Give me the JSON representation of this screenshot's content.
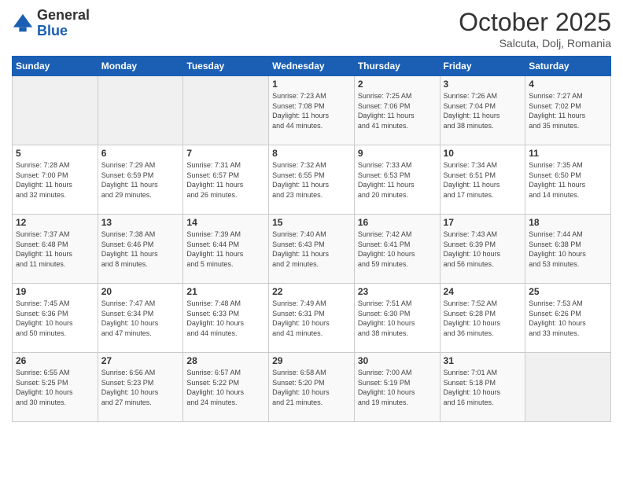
{
  "header": {
    "logo_general": "General",
    "logo_blue": "Blue",
    "month": "October 2025",
    "location": "Salcuta, Dolj, Romania"
  },
  "days_of_week": [
    "Sunday",
    "Monday",
    "Tuesday",
    "Wednesday",
    "Thursday",
    "Friday",
    "Saturday"
  ],
  "weeks": [
    [
      {
        "num": "",
        "info": ""
      },
      {
        "num": "",
        "info": ""
      },
      {
        "num": "",
        "info": ""
      },
      {
        "num": "1",
        "info": "Sunrise: 7:23 AM\nSunset: 7:08 PM\nDaylight: 11 hours\nand 44 minutes."
      },
      {
        "num": "2",
        "info": "Sunrise: 7:25 AM\nSunset: 7:06 PM\nDaylight: 11 hours\nand 41 minutes."
      },
      {
        "num": "3",
        "info": "Sunrise: 7:26 AM\nSunset: 7:04 PM\nDaylight: 11 hours\nand 38 minutes."
      },
      {
        "num": "4",
        "info": "Sunrise: 7:27 AM\nSunset: 7:02 PM\nDaylight: 11 hours\nand 35 minutes."
      }
    ],
    [
      {
        "num": "5",
        "info": "Sunrise: 7:28 AM\nSunset: 7:00 PM\nDaylight: 11 hours\nand 32 minutes."
      },
      {
        "num": "6",
        "info": "Sunrise: 7:29 AM\nSunset: 6:59 PM\nDaylight: 11 hours\nand 29 minutes."
      },
      {
        "num": "7",
        "info": "Sunrise: 7:31 AM\nSunset: 6:57 PM\nDaylight: 11 hours\nand 26 minutes."
      },
      {
        "num": "8",
        "info": "Sunrise: 7:32 AM\nSunset: 6:55 PM\nDaylight: 11 hours\nand 23 minutes."
      },
      {
        "num": "9",
        "info": "Sunrise: 7:33 AM\nSunset: 6:53 PM\nDaylight: 11 hours\nand 20 minutes."
      },
      {
        "num": "10",
        "info": "Sunrise: 7:34 AM\nSunset: 6:51 PM\nDaylight: 11 hours\nand 17 minutes."
      },
      {
        "num": "11",
        "info": "Sunrise: 7:35 AM\nSunset: 6:50 PM\nDaylight: 11 hours\nand 14 minutes."
      }
    ],
    [
      {
        "num": "12",
        "info": "Sunrise: 7:37 AM\nSunset: 6:48 PM\nDaylight: 11 hours\nand 11 minutes."
      },
      {
        "num": "13",
        "info": "Sunrise: 7:38 AM\nSunset: 6:46 PM\nDaylight: 11 hours\nand 8 minutes."
      },
      {
        "num": "14",
        "info": "Sunrise: 7:39 AM\nSunset: 6:44 PM\nDaylight: 11 hours\nand 5 minutes."
      },
      {
        "num": "15",
        "info": "Sunrise: 7:40 AM\nSunset: 6:43 PM\nDaylight: 11 hours\nand 2 minutes."
      },
      {
        "num": "16",
        "info": "Sunrise: 7:42 AM\nSunset: 6:41 PM\nDaylight: 10 hours\nand 59 minutes."
      },
      {
        "num": "17",
        "info": "Sunrise: 7:43 AM\nSunset: 6:39 PM\nDaylight: 10 hours\nand 56 minutes."
      },
      {
        "num": "18",
        "info": "Sunrise: 7:44 AM\nSunset: 6:38 PM\nDaylight: 10 hours\nand 53 minutes."
      }
    ],
    [
      {
        "num": "19",
        "info": "Sunrise: 7:45 AM\nSunset: 6:36 PM\nDaylight: 10 hours\nand 50 minutes."
      },
      {
        "num": "20",
        "info": "Sunrise: 7:47 AM\nSunset: 6:34 PM\nDaylight: 10 hours\nand 47 minutes."
      },
      {
        "num": "21",
        "info": "Sunrise: 7:48 AM\nSunset: 6:33 PM\nDaylight: 10 hours\nand 44 minutes."
      },
      {
        "num": "22",
        "info": "Sunrise: 7:49 AM\nSunset: 6:31 PM\nDaylight: 10 hours\nand 41 minutes."
      },
      {
        "num": "23",
        "info": "Sunrise: 7:51 AM\nSunset: 6:30 PM\nDaylight: 10 hours\nand 38 minutes."
      },
      {
        "num": "24",
        "info": "Sunrise: 7:52 AM\nSunset: 6:28 PM\nDaylight: 10 hours\nand 36 minutes."
      },
      {
        "num": "25",
        "info": "Sunrise: 7:53 AM\nSunset: 6:26 PM\nDaylight: 10 hours\nand 33 minutes."
      }
    ],
    [
      {
        "num": "26",
        "info": "Sunrise: 6:55 AM\nSunset: 5:25 PM\nDaylight: 10 hours\nand 30 minutes."
      },
      {
        "num": "27",
        "info": "Sunrise: 6:56 AM\nSunset: 5:23 PM\nDaylight: 10 hours\nand 27 minutes."
      },
      {
        "num": "28",
        "info": "Sunrise: 6:57 AM\nSunset: 5:22 PM\nDaylight: 10 hours\nand 24 minutes."
      },
      {
        "num": "29",
        "info": "Sunrise: 6:58 AM\nSunset: 5:20 PM\nDaylight: 10 hours\nand 21 minutes."
      },
      {
        "num": "30",
        "info": "Sunrise: 7:00 AM\nSunset: 5:19 PM\nDaylight: 10 hours\nand 19 minutes."
      },
      {
        "num": "31",
        "info": "Sunrise: 7:01 AM\nSunset: 5:18 PM\nDaylight: 10 hours\nand 16 minutes."
      },
      {
        "num": "",
        "info": ""
      }
    ]
  ]
}
